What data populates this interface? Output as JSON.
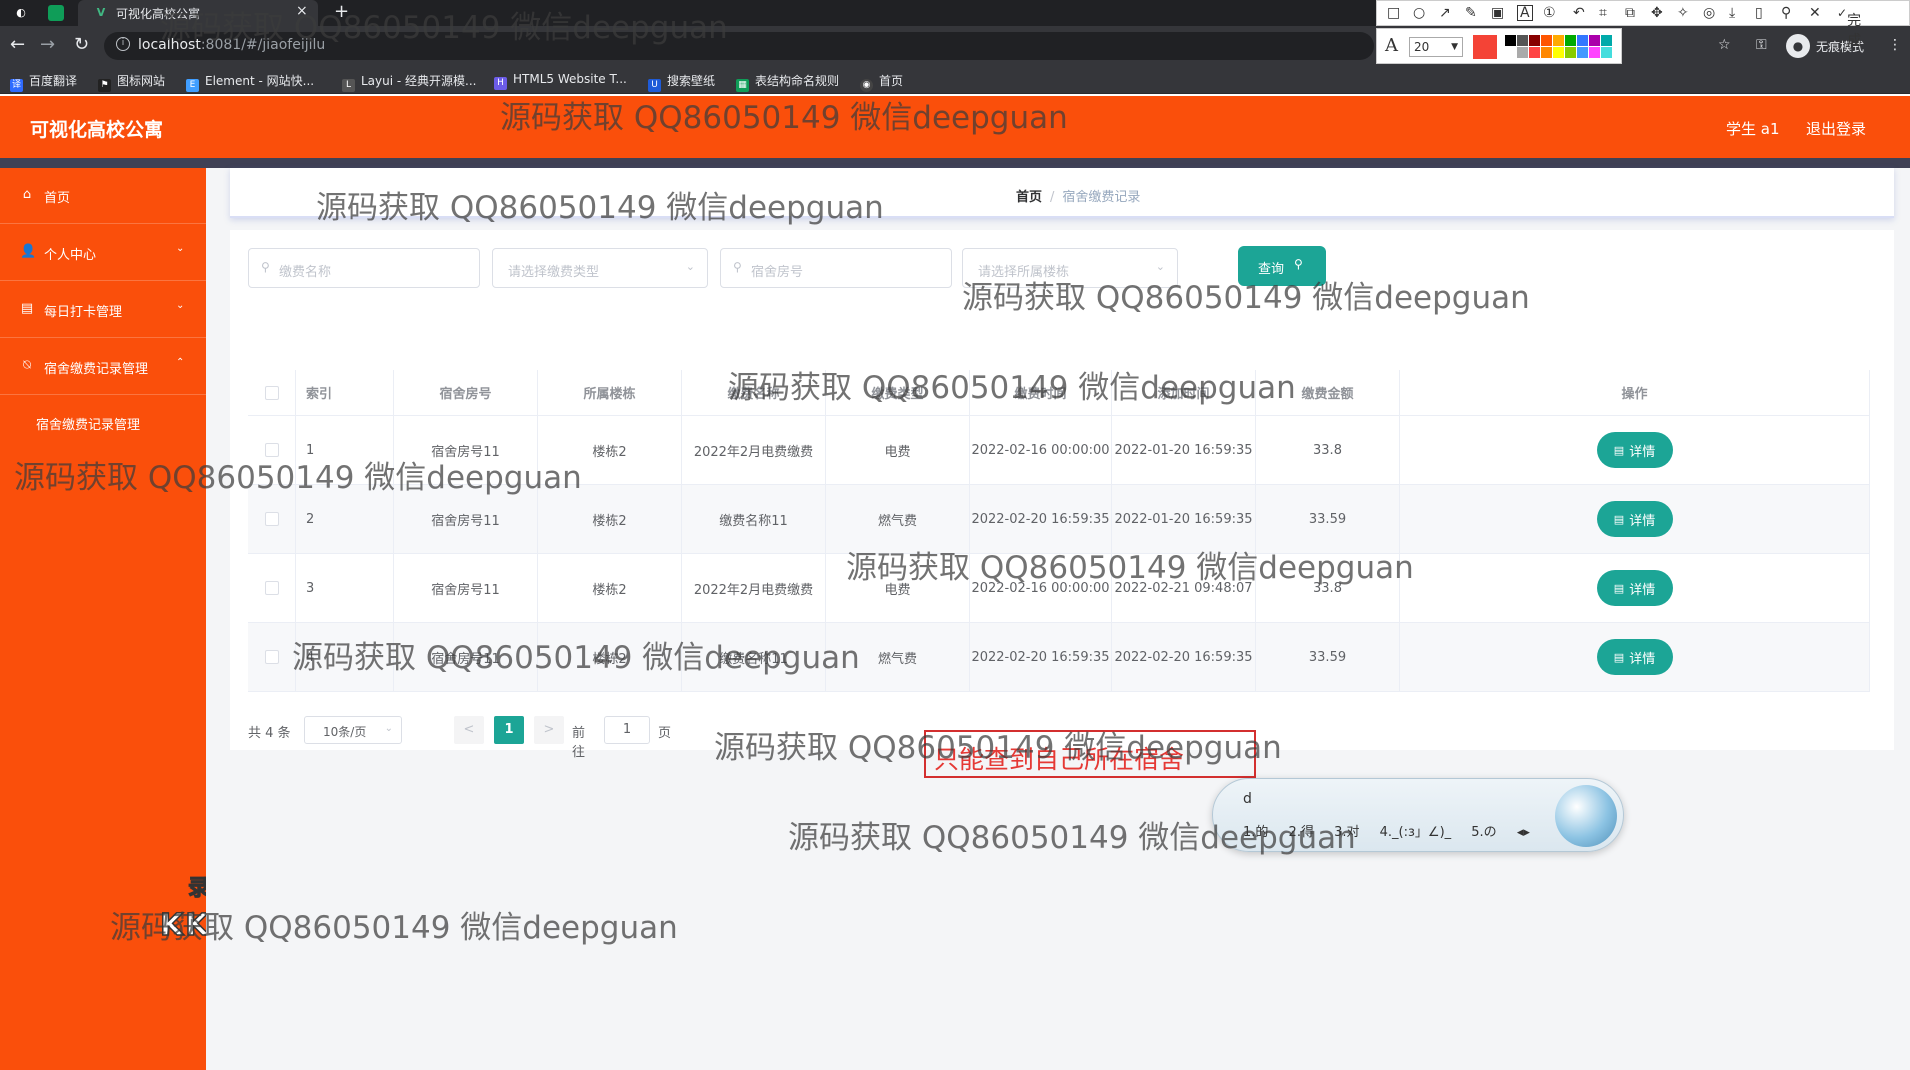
{
  "browser": {
    "tab_title": "可视化高校公寓",
    "tab_close": "×",
    "new_tab": "+",
    "url_host": "localhost",
    "url_path": ":8081/#/jiaofeijilu",
    "profile_label": "无痕模式",
    "bookmarks": [
      "百度翻译",
      "图标网站",
      "Element - 网站快...",
      "Layui - 经典开源模...",
      "HTML5 Website T...",
      "搜索壁纸",
      "表结构命名规则",
      "首页"
    ],
    "icons": [
      "back-arrow-icon",
      "forward-arrow-icon",
      "reload-icon",
      "info-icon",
      "star-icon",
      "key-icon",
      "menu-dots-icon"
    ]
  },
  "annotation_tool": {
    "font_size": "20",
    "done_label": "完成",
    "current_color": "#f44336",
    "palette": [
      "#000000",
      "#555555",
      "#880000",
      "#ff5500",
      "#ffaa00",
      "#00aa00",
      "#3377ff",
      "#aa00aa",
      "#00aaaa",
      "#ffffff",
      "#aaaaaa",
      "#ff4444",
      "#ff8800",
      "#ffff00",
      "#88cc00",
      "#4499ff",
      "#ff44ff",
      "#44dddd"
    ]
  },
  "header": {
    "brand": "可视化高校公寓",
    "user": "学生 a1",
    "logout": "退出登录",
    "color": "#fa4f0b"
  },
  "sidebar": {
    "items": [
      {
        "label": "首页",
        "icon": "home-icon"
      },
      {
        "label": "个人中心",
        "icon": "user-icon",
        "arrow": "⌄"
      },
      {
        "label": "每日打卡管理",
        "icon": "briefcase-icon",
        "arrow": "⌄"
      },
      {
        "label": "宿舍缴费记录管理",
        "icon": "bell-off-icon",
        "arrow": "⌃"
      }
    ],
    "submenu": [
      "宿舍缴费记录管理"
    ],
    "record_logo_line1": "录制工具",
    "record_logo_line2": "KK录像机"
  },
  "breadcrumb": {
    "home": "首页",
    "separator": "/",
    "current": "宿舍缴费记录"
  },
  "search": {
    "fee_name_placeholder": "缴费名称",
    "fee_type_placeholder": "请选择缴费类型",
    "room_placeholder": "宿舍房号",
    "building_placeholder": "请选择所属楼栋",
    "button": "查询"
  },
  "table": {
    "headers": [
      "索引",
      "宿舍房号",
      "所属楼栋",
      "缴费名称",
      "缴费类型",
      "缴费时间",
      "添加时间",
      "缴费金额",
      "操作"
    ],
    "detail_label": "详情",
    "rows": [
      [
        "1",
        "宿舍房号11",
        "楼栋2",
        "2022年2月电费缴费",
        "电费",
        "2022-02-16 00:00:00",
        "2022-01-20 16:59:35",
        "33.8"
      ],
      [
        "2",
        "宿舍房号11",
        "楼栋2",
        "缴费名称11",
        "燃气费",
        "2022-02-20 16:59:35",
        "2022-01-20 16:59:35",
        "33.59"
      ],
      [
        "3",
        "宿舍房号11",
        "楼栋2",
        "2022年2月电费缴费",
        "电费",
        "2022-02-16 00:00:00",
        "2022-02-21 09:48:07",
        "33.8"
      ],
      [
        "4",
        "宿舍房号11",
        "楼栋2",
        "缴费名称11",
        "燃气费",
        "2022-02-20 16:59:35",
        "2022-02-20 16:59:35",
        "33.59"
      ]
    ]
  },
  "pagination": {
    "total": "共 4 条",
    "page_size": "10条/页",
    "prev": "<",
    "current": "1",
    "next": ">",
    "goto": "前往",
    "goto_value": "1",
    "page_suffix": "页"
  },
  "note": "只能查到自己所在宿舍",
  "ime": {
    "composition": "d",
    "candidates": [
      "1.的",
      "2.得",
      "3.对",
      "4._(:з」∠)_",
      "5.の"
    ]
  },
  "watermark": "源码获取 QQ86050149 微信deepguan"
}
